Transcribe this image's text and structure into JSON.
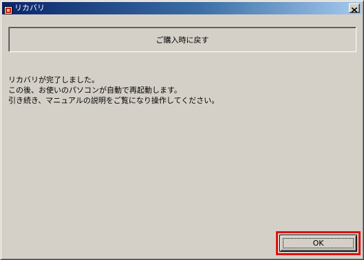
{
  "window": {
    "title": "リカバリ",
    "close_glyph": "×"
  },
  "restore": {
    "label": "ご購入時に戻す"
  },
  "message": {
    "lines": [
      "リカバリが完了しました。",
      "この後、お使いのパソコンが自動で再起動します。",
      "引き続き、マニュアルの説明をご覧になり操作してください。"
    ]
  },
  "ok_button": {
    "label": "OK"
  },
  "colors": {
    "dialog_face": "#d4d0c8",
    "titlebar_start": "#0a246a",
    "titlebar_end": "#a6caf0",
    "highlight": "#e01010"
  },
  "icons": {
    "app": "app-icon",
    "close": "close-icon"
  }
}
